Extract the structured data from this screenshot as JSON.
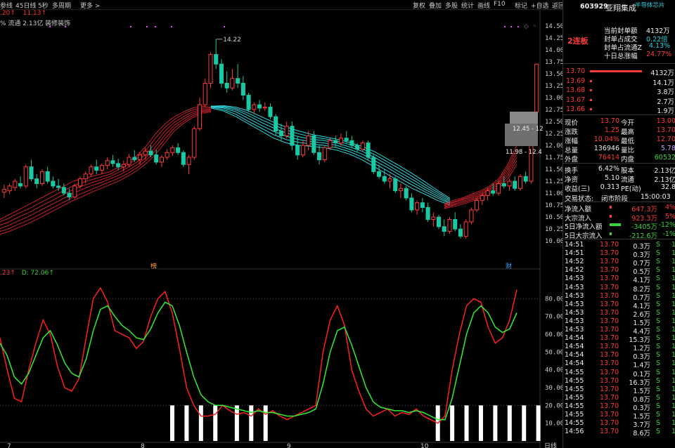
{
  "toolbar": {
    "left_items": [
      "参线",
      "45日线",
      "5秒",
      "多周期",
      "更多 >"
    ],
    "right_items": [
      "复权",
      "叠加",
      "多股",
      "统计",
      "画线",
      "F10",
      "标记",
      "+自选",
      "返回"
    ]
  },
  "main_chart": {
    "ma_line_a": ".20↑",
    "ma_line_b": "11.13↑",
    "info_text": "% 流通 2.13亿 装修装饰",
    "high_label": "14.22",
    "box1_label": "12.45 - 12",
    "box2_label": "11.98 - 12.4",
    "marker_1": "榜",
    "marker_2": "财",
    "y_ticks": [
      "14.50",
      "14.25",
      "14.00",
      "13.75",
      "13.50",
      "13.25",
      "13.00",
      "12.75",
      "12.50",
      "12.25",
      "12.00",
      "11.75",
      "11.50",
      "11.25",
      "11.00",
      "10.75",
      "10.50",
      "10.25",
      "10.00"
    ]
  },
  "kdj_chart": {
    "label_k": ".23↑",
    "label_d": "D: 72.06↑",
    "y_ticks": [
      "80.00",
      "70.00",
      "60.00",
      "50.00",
      "40.00",
      "30.00",
      "20.00",
      "10.00"
    ],
    "x_ticks": [
      "7",
      "8",
      "9",
      "10"
    ],
    "period_label": "日线"
  },
  "stock": {
    "code": "603929",
    "name": "亚翔集成",
    "tag": "半导体芯片",
    "board": "2连板",
    "seal_amount_label": "当前封单额",
    "seal_amount": "4132万",
    "seal_vs_turnover_label": "封单占成交",
    "seal_vs_turnover": "0.22倍",
    "seal_vs_float_label": "封单占流通Z",
    "seal_vs_float": "4.13%",
    "ten_day_gain_label": "十日总涨幅",
    "ten_day_gain": "24.77%"
  },
  "bids": [
    {
      "price": "13.70",
      "vol": "4132万"
    },
    {
      "price": "13.69",
      "vol": "14.1万"
    },
    {
      "price": "13.68",
      "vol": "3.8万"
    },
    {
      "price": "13.67",
      "vol": "2.7万"
    },
    {
      "price": "13.66",
      "vol": "1.9万"
    }
  ],
  "quote": [
    {
      "l1": "现价",
      "v1": "13.70",
      "l2": "今开",
      "v2": "13.00"
    },
    {
      "l1": "涨跌",
      "v1": "1.25",
      "l2": "最高",
      "v2": "13.70"
    },
    {
      "l1": "涨幅",
      "v1": "10.04%",
      "l2": "最低",
      "v2": "12.70"
    },
    {
      "l1": "总量",
      "v1": "136946",
      "l2": "量比",
      "v2": "5.78"
    },
    {
      "l1": "外盘",
      "v1": "76414",
      "l2": "内盘",
      "v2": "60532"
    },
    {
      "l1": "换手",
      "v1": "6.42%",
      "l2": "股本",
      "v2": "2.13亿"
    },
    {
      "l1": "净资",
      "v1": "5.10",
      "l2": "流通",
      "v2": "2.13亿"
    },
    {
      "l1": "收益(三)",
      "v1": "0.313",
      "l2": "PE(动)",
      "v2": "32.8"
    }
  ],
  "trade_status_label": "交易状态:",
  "trade_status": "闭市阶段",
  "trade_time": "15:00:03",
  "flows": [
    {
      "label": "净流入额",
      "value": "647.3万",
      "pct": "4%",
      "bar": 0.0,
      "color": "#ff3b3b"
    },
    {
      "label": "大宗流入",
      "value": "923.3万",
      "pct": "5%",
      "bar": 0.0,
      "color": "#ff3b3b"
    },
    {
      "label": "5日净流入额",
      "value": "-3405万",
      "pct": "-12%",
      "bar": 1.0,
      "color": "#3cd33c"
    },
    {
      "label": "5日大宗流入",
      "value": "-212.6万",
      "pct": "-1%",
      "bar": 0.0,
      "color": "#3cd33c"
    }
  ],
  "ticks": [
    {
      "t": "14:51",
      "p": "13.70",
      "v": "0.3万",
      "s": "S"
    },
    {
      "t": "14:51",
      "p": "13.70",
      "v": "0.3万",
      "s": "S"
    },
    {
      "t": "14:52",
      "p": "13.70",
      "v": "0.7万",
      "s": "S"
    },
    {
      "t": "14:52",
      "p": "13.70",
      "v": "0.5万",
      "s": "S"
    },
    {
      "t": "14:53",
      "p": "13.70",
      "v": "4.1万",
      "s": "S"
    },
    {
      "t": "14:53",
      "p": "13.70",
      "v": "8.2万",
      "s": "S"
    },
    {
      "t": "14:53",
      "p": "13.70",
      "v": "0.7万",
      "s": "S"
    },
    {
      "t": "14:53",
      "p": "13.70",
      "v": "4.1万",
      "s": "S"
    },
    {
      "t": "14:53",
      "p": "13.70",
      "v": "2.6万",
      "s": "S"
    },
    {
      "t": "14:53",
      "p": "13.70",
      "v": "1.5万",
      "s": "S"
    },
    {
      "t": "14:53",
      "p": "13.70",
      "v": "4.4万",
      "s": "S"
    },
    {
      "t": "14:54",
      "p": "13.70",
      "v": "15.3万",
      "s": "S"
    },
    {
      "t": "14:54",
      "p": "13.70",
      "v": "1.2万",
      "s": "S"
    },
    {
      "t": "14:54",
      "p": "13.70",
      "v": "0.3万",
      "s": "S"
    },
    {
      "t": "14:54",
      "p": "13.70",
      "v": "1.4万",
      "s": "S"
    },
    {
      "t": "14:55",
      "p": "13.70",
      "v": "0.1万",
      "s": "S"
    },
    {
      "t": "14:55",
      "p": "13.70",
      "v": "16.3万",
      "s": "S"
    },
    {
      "t": "14:55",
      "p": "13.70",
      "v": "1.5万",
      "s": "S"
    },
    {
      "t": "14:55",
      "p": "13.70",
      "v": "0.8万",
      "s": "S"
    },
    {
      "t": "14:55",
      "p": "13.70",
      "v": "0.3万",
      "s": "S"
    },
    {
      "t": "14:55",
      "p": "13.70",
      "v": "1.5万",
      "s": "S"
    },
    {
      "t": "14:55",
      "p": "13.70",
      "v": "3.7万",
      "s": "S"
    },
    {
      "t": "14:56",
      "p": "13.70",
      "v": "8.6万",
      "s": "S"
    }
  ],
  "colors": {
    "up": "#ff3b3b",
    "down": "#19c9a4",
    "ma_red": "#c8202a",
    "ma_cyan": "#2fd8e0",
    "k": "#ff2020",
    "d": "#33ee33"
  },
  "chart_data": {
    "type": "candlestick",
    "ylim": [
      9.9,
      14.6
    ],
    "candles": [
      [
        11.02,
        11.18,
        10.9,
        11.08
      ],
      [
        11.05,
        11.2,
        10.98,
        11.15
      ],
      [
        11.12,
        11.3,
        11.05,
        11.25
      ],
      [
        11.2,
        11.35,
        11.1,
        11.15
      ],
      [
        11.15,
        11.6,
        11.1,
        11.55
      ],
      [
        11.55,
        11.7,
        11.25,
        11.3
      ],
      [
        11.3,
        11.4,
        11.1,
        11.2
      ],
      [
        11.2,
        11.5,
        11.15,
        11.45
      ],
      [
        11.45,
        11.55,
        11.2,
        11.25
      ],
      [
        11.25,
        11.35,
        11.1,
        11.15
      ],
      [
        11.15,
        11.3,
        11.05,
        11.12
      ],
      [
        11.12,
        11.2,
        10.95,
        11.0
      ],
      [
        11.0,
        11.1,
        10.85,
        10.92
      ],
      [
        10.92,
        11.2,
        10.88,
        11.15
      ],
      [
        11.15,
        11.35,
        11.1,
        11.3
      ],
      [
        11.3,
        11.45,
        11.2,
        11.4
      ],
      [
        11.4,
        11.6,
        11.35,
        11.55
      ],
      [
        11.55,
        11.7,
        11.4,
        11.48
      ],
      [
        11.48,
        11.62,
        11.4,
        11.58
      ],
      [
        11.58,
        11.75,
        11.5,
        11.68
      ],
      [
        11.68,
        11.8,
        11.55,
        11.62
      ],
      [
        11.62,
        11.72,
        11.48,
        11.55
      ],
      [
        11.55,
        11.68,
        11.45,
        11.6
      ],
      [
        11.6,
        11.82,
        11.55,
        11.75
      ],
      [
        11.75,
        11.9,
        11.65,
        11.7
      ],
      [
        11.7,
        11.85,
        11.6,
        11.8
      ],
      [
        11.8,
        11.95,
        11.7,
        11.88
      ],
      [
        11.88,
        12.0,
        11.75,
        11.8
      ],
      [
        11.8,
        11.9,
        11.6,
        11.65
      ],
      [
        11.65,
        11.8,
        11.55,
        11.75
      ],
      [
        11.75,
        11.92,
        11.7,
        11.85
      ],
      [
        11.85,
        12.0,
        11.78,
        11.95
      ],
      [
        11.95,
        12.05,
        11.8,
        11.85
      ],
      [
        11.85,
        11.9,
        11.55,
        11.6
      ],
      [
        11.6,
        11.8,
        11.4,
        11.75
      ],
      [
        11.75,
        12.4,
        11.7,
        12.35
      ],
      [
        12.35,
        13.0,
        12.3,
        12.85
      ],
      [
        12.85,
        13.4,
        12.8,
        13.3
      ],
      [
        13.3,
        13.95,
        13.2,
        13.9
      ],
      [
        13.9,
        14.22,
        13.6,
        13.7
      ],
      [
        13.7,
        13.8,
        13.2,
        13.3
      ],
      [
        13.3,
        13.55,
        13.1,
        13.2
      ],
      [
        13.2,
        13.6,
        13.15,
        13.4
      ],
      [
        13.4,
        13.7,
        13.2,
        13.3
      ],
      [
        13.3,
        13.45,
        12.95,
        13.05
      ],
      [
        13.05,
        13.1,
        12.7,
        12.75
      ],
      [
        12.75,
        12.9,
        12.65,
        12.85
      ],
      [
        12.85,
        12.95,
        12.7,
        12.78
      ],
      [
        12.78,
        12.9,
        12.72,
        12.8
      ],
      [
        12.8,
        12.88,
        12.55,
        12.6
      ],
      [
        12.6,
        12.65,
        12.2,
        12.3
      ],
      [
        12.3,
        12.45,
        12.1,
        12.2
      ],
      [
        12.2,
        12.5,
        12.15,
        12.4
      ],
      [
        12.4,
        12.5,
        11.9,
        12.0
      ],
      [
        12.0,
        12.2,
        11.7,
        11.8
      ],
      [
        11.8,
        12.1,
        11.75,
        12.0
      ],
      [
        12.0,
        12.3,
        11.9,
        12.2
      ],
      [
        12.2,
        12.3,
        11.8,
        11.85
      ],
      [
        11.85,
        12.0,
        11.6,
        11.7
      ],
      [
        11.7,
        12.0,
        11.65,
        11.95
      ],
      [
        11.95,
        12.15,
        11.9,
        12.1
      ],
      [
        12.1,
        12.2,
        11.95,
        12.05
      ],
      [
        12.05,
        12.25,
        12.0,
        12.15
      ],
      [
        12.15,
        12.3,
        12.05,
        12.1
      ],
      [
        12.1,
        12.2,
        11.95,
        12.0
      ],
      [
        12.0,
        12.05,
        11.85,
        11.92
      ],
      [
        11.92,
        12.1,
        11.88,
        12.05
      ],
      [
        12.05,
        12.1,
        11.7,
        11.75
      ],
      [
        11.75,
        11.8,
        11.4,
        11.45
      ],
      [
        11.45,
        11.6,
        11.3,
        11.35
      ],
      [
        11.35,
        11.5,
        11.2,
        11.25
      ],
      [
        11.25,
        11.4,
        11.1,
        11.3
      ],
      [
        11.3,
        11.35,
        11.0,
        11.05
      ],
      [
        11.05,
        11.2,
        10.9,
        11.1
      ],
      [
        11.1,
        11.15,
        10.85,
        10.9
      ],
      [
        10.9,
        11.0,
        10.6,
        10.65
      ],
      [
        10.65,
        10.85,
        10.55,
        10.8
      ],
      [
        10.8,
        10.9,
        10.6,
        10.7
      ],
      [
        10.7,
        10.8,
        10.4,
        10.45
      ],
      [
        10.45,
        10.6,
        10.3,
        10.5
      ],
      [
        10.5,
        10.55,
        10.25,
        10.3
      ],
      [
        10.3,
        10.45,
        10.1,
        10.2
      ],
      [
        10.2,
        10.5,
        10.15,
        10.45
      ],
      [
        10.45,
        10.6,
        10.2,
        10.25
      ],
      [
        10.25,
        10.35,
        10.05,
        10.1
      ],
      [
        10.1,
        10.45,
        10.05,
        10.4
      ],
      [
        10.4,
        10.7,
        10.35,
        10.65
      ],
      [
        10.65,
        10.9,
        10.6,
        10.85
      ],
      [
        10.85,
        11.0,
        10.75,
        10.95
      ],
      [
        10.95,
        11.1,
        10.85,
        11.05
      ],
      [
        11.05,
        11.2,
        10.95,
        11.0
      ],
      [
        11.0,
        11.25,
        10.95,
        11.2
      ],
      [
        11.2,
        11.35,
        11.1,
        11.15
      ],
      [
        11.15,
        11.3,
        11.05,
        11.25
      ],
      [
        11.25,
        11.35,
        11.05,
        11.1
      ],
      [
        11.1,
        11.4,
        11.05,
        11.35
      ],
      [
        11.35,
        11.45,
        11.2,
        11.25
      ],
      [
        11.25,
        12.45,
        11.2,
        12.45
      ],
      [
        12.7,
        13.7,
        12.7,
        13.7
      ]
    ],
    "ma_red_bands": [
      [
        10.45,
        10.55,
        10.65,
        10.75,
        10.85,
        10.95,
        11.05,
        11.15,
        11.25,
        11.3,
        11.35,
        11.4,
        11.45,
        11.55,
        11.65,
        11.8,
        12.0,
        12.25,
        12.45,
        12.6,
        12.7,
        12.78,
        12.82,
        12.8
      ],
      [
        10.4,
        10.48,
        10.58,
        10.66,
        10.76,
        10.86,
        10.96,
        11.06,
        11.16,
        11.22,
        11.28,
        11.34,
        11.4,
        11.5,
        11.6,
        11.74,
        11.92,
        12.16,
        12.38,
        12.54,
        12.66,
        12.74,
        12.78,
        12.78
      ],
      [
        10.33,
        10.4,
        10.5,
        10.58,
        10.68,
        10.78,
        10.88,
        10.98,
        11.08,
        11.15,
        11.22,
        11.28,
        11.35,
        11.44,
        11.54,
        11.66,
        11.84,
        12.06,
        12.3,
        12.48,
        12.6,
        12.7,
        12.75,
        12.76
      ],
      [
        10.26,
        10.33,
        10.42,
        10.5,
        10.6,
        10.7,
        10.8,
        10.9,
        11.0,
        11.08,
        11.16,
        11.22,
        11.3,
        11.38,
        11.48,
        11.6,
        11.76,
        11.98,
        12.22,
        12.42,
        12.55,
        12.66,
        12.72,
        12.74
      ],
      [
        10.2,
        10.26,
        10.35,
        10.43,
        10.52,
        10.62,
        10.72,
        10.82,
        10.92,
        11.0,
        11.08,
        11.16,
        11.24,
        11.32,
        11.42,
        11.54,
        11.7,
        11.9,
        12.14,
        12.36,
        12.5,
        12.62,
        12.7,
        12.72
      ],
      [
        10.14,
        10.2,
        10.28,
        10.36,
        10.45,
        10.55,
        10.65,
        10.75,
        10.85,
        10.93,
        11.02,
        11.1,
        11.18,
        11.26,
        11.36,
        11.48,
        11.63,
        11.82,
        12.06,
        12.3,
        12.46,
        12.58,
        12.67,
        12.7
      ]
    ],
    "ma_cyan_bands": [
      [
        12.78,
        12.72,
        12.6,
        12.45,
        12.3,
        12.15,
        12.05,
        12.0,
        11.98,
        11.95,
        11.9,
        11.82,
        11.7,
        11.55,
        11.4,
        11.25,
        11.1,
        10.98,
        10.85,
        10.75
      ],
      [
        12.8,
        12.75,
        12.65,
        12.5,
        12.36,
        12.22,
        12.12,
        12.06,
        12.03,
        12.0,
        11.95,
        11.87,
        11.76,
        11.62,
        11.47,
        11.32,
        11.17,
        11.03,
        10.9,
        10.78
      ],
      [
        12.81,
        12.78,
        12.7,
        12.56,
        12.42,
        12.29,
        12.19,
        12.12,
        12.08,
        12.05,
        12.0,
        11.92,
        11.82,
        11.68,
        11.54,
        11.38,
        11.23,
        11.08,
        10.94,
        10.8
      ],
      [
        12.82,
        12.8,
        12.74,
        12.62,
        12.48,
        12.36,
        12.26,
        12.18,
        12.13,
        12.1,
        12.05,
        11.97,
        11.88,
        11.75,
        11.6,
        11.44,
        11.29,
        11.13,
        10.98,
        10.83
      ],
      [
        12.82,
        12.82,
        12.77,
        12.67,
        12.54,
        12.42,
        12.32,
        12.24,
        12.18,
        12.14,
        12.09,
        12.02,
        11.93,
        11.81,
        11.66,
        11.51,
        11.35,
        11.18,
        11.02,
        10.86
      ],
      [
        12.82,
        12.83,
        12.8,
        12.72,
        12.6,
        12.48,
        12.38,
        12.3,
        12.23,
        12.18,
        12.13,
        12.06,
        11.98,
        11.87,
        11.72,
        11.57,
        11.41,
        11.24,
        11.06,
        10.89
      ]
    ],
    "kdj_k": [
      58,
      40,
      24,
      22,
      40,
      55,
      68,
      60,
      42,
      30,
      28,
      35,
      58,
      80,
      86,
      78,
      62,
      60,
      58,
      52,
      56,
      70,
      80,
      84,
      72,
      52,
      30,
      20,
      14,
      14,
      15,
      20,
      17,
      15,
      16,
      14,
      18,
      15,
      17,
      14,
      12,
      14,
      16,
      18,
      20,
      50,
      68,
      76,
      65,
      40,
      28,
      18,
      14,
      16,
      18,
      14,
      16,
      15,
      18,
      14,
      12,
      10,
      14,
      40,
      60,
      76,
      80,
      78,
      64,
      55,
      58,
      68,
      85
    ],
    "kdj_d": [
      55,
      48,
      36,
      32,
      38,
      48,
      58,
      62,
      54,
      44,
      38,
      36,
      46,
      62,
      74,
      76,
      70,
      65,
      62,
      58,
      57,
      63,
      72,
      78,
      76,
      65,
      50,
      36,
      26,
      22,
      20,
      20,
      19,
      18,
      17,
      16,
      17,
      16,
      16,
      15,
      14,
      14,
      15,
      16,
      18,
      32,
      50,
      62,
      64,
      54,
      42,
      30,
      22,
      19,
      18,
      17,
      17,
      16,
      17,
      16,
      14,
      12,
      12,
      24,
      42,
      60,
      72,
      76,
      72,
      64,
      61,
      63,
      72
    ],
    "kdj_bars": [
      24,
      26,
      28,
      30,
      33,
      35,
      37,
      61,
      63,
      65,
      67,
      69,
      71,
      73,
      75
    ]
  }
}
